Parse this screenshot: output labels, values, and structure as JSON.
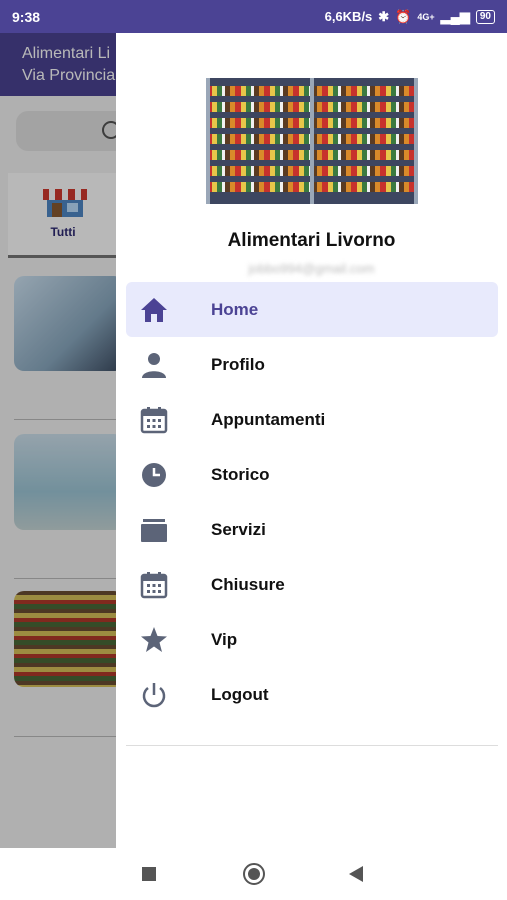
{
  "status_bar": {
    "time": "9:38",
    "net_speed": "6,6KB/s",
    "signal": "4G+",
    "battery": "90"
  },
  "app": {
    "header_line1": "Alimentari Li",
    "header_line2": "Via Provincia",
    "tab_label": "Tutti"
  },
  "drawer": {
    "store_name": "Alimentari Livorno",
    "email": "jobbo994@gmail.com",
    "menu": [
      {
        "label": "Home",
        "icon": "home-icon",
        "active": true
      },
      {
        "label": "Profilo",
        "icon": "person-icon",
        "active": false
      },
      {
        "label": "Appuntamenti",
        "icon": "calendar-icon",
        "active": false
      },
      {
        "label": "Storico",
        "icon": "clock-icon",
        "active": false
      },
      {
        "label": "Servizi",
        "icon": "box-icon",
        "active": false
      },
      {
        "label": "Chiusure",
        "icon": "calendar-icon",
        "active": false
      },
      {
        "label": "Vip",
        "icon": "star-icon",
        "active": false
      },
      {
        "label": "Logout",
        "icon": "power-icon",
        "active": false
      }
    ]
  },
  "colors": {
    "brand": "#4b4394",
    "icon": "#5c6478",
    "active_bg": "#e8eafc"
  }
}
